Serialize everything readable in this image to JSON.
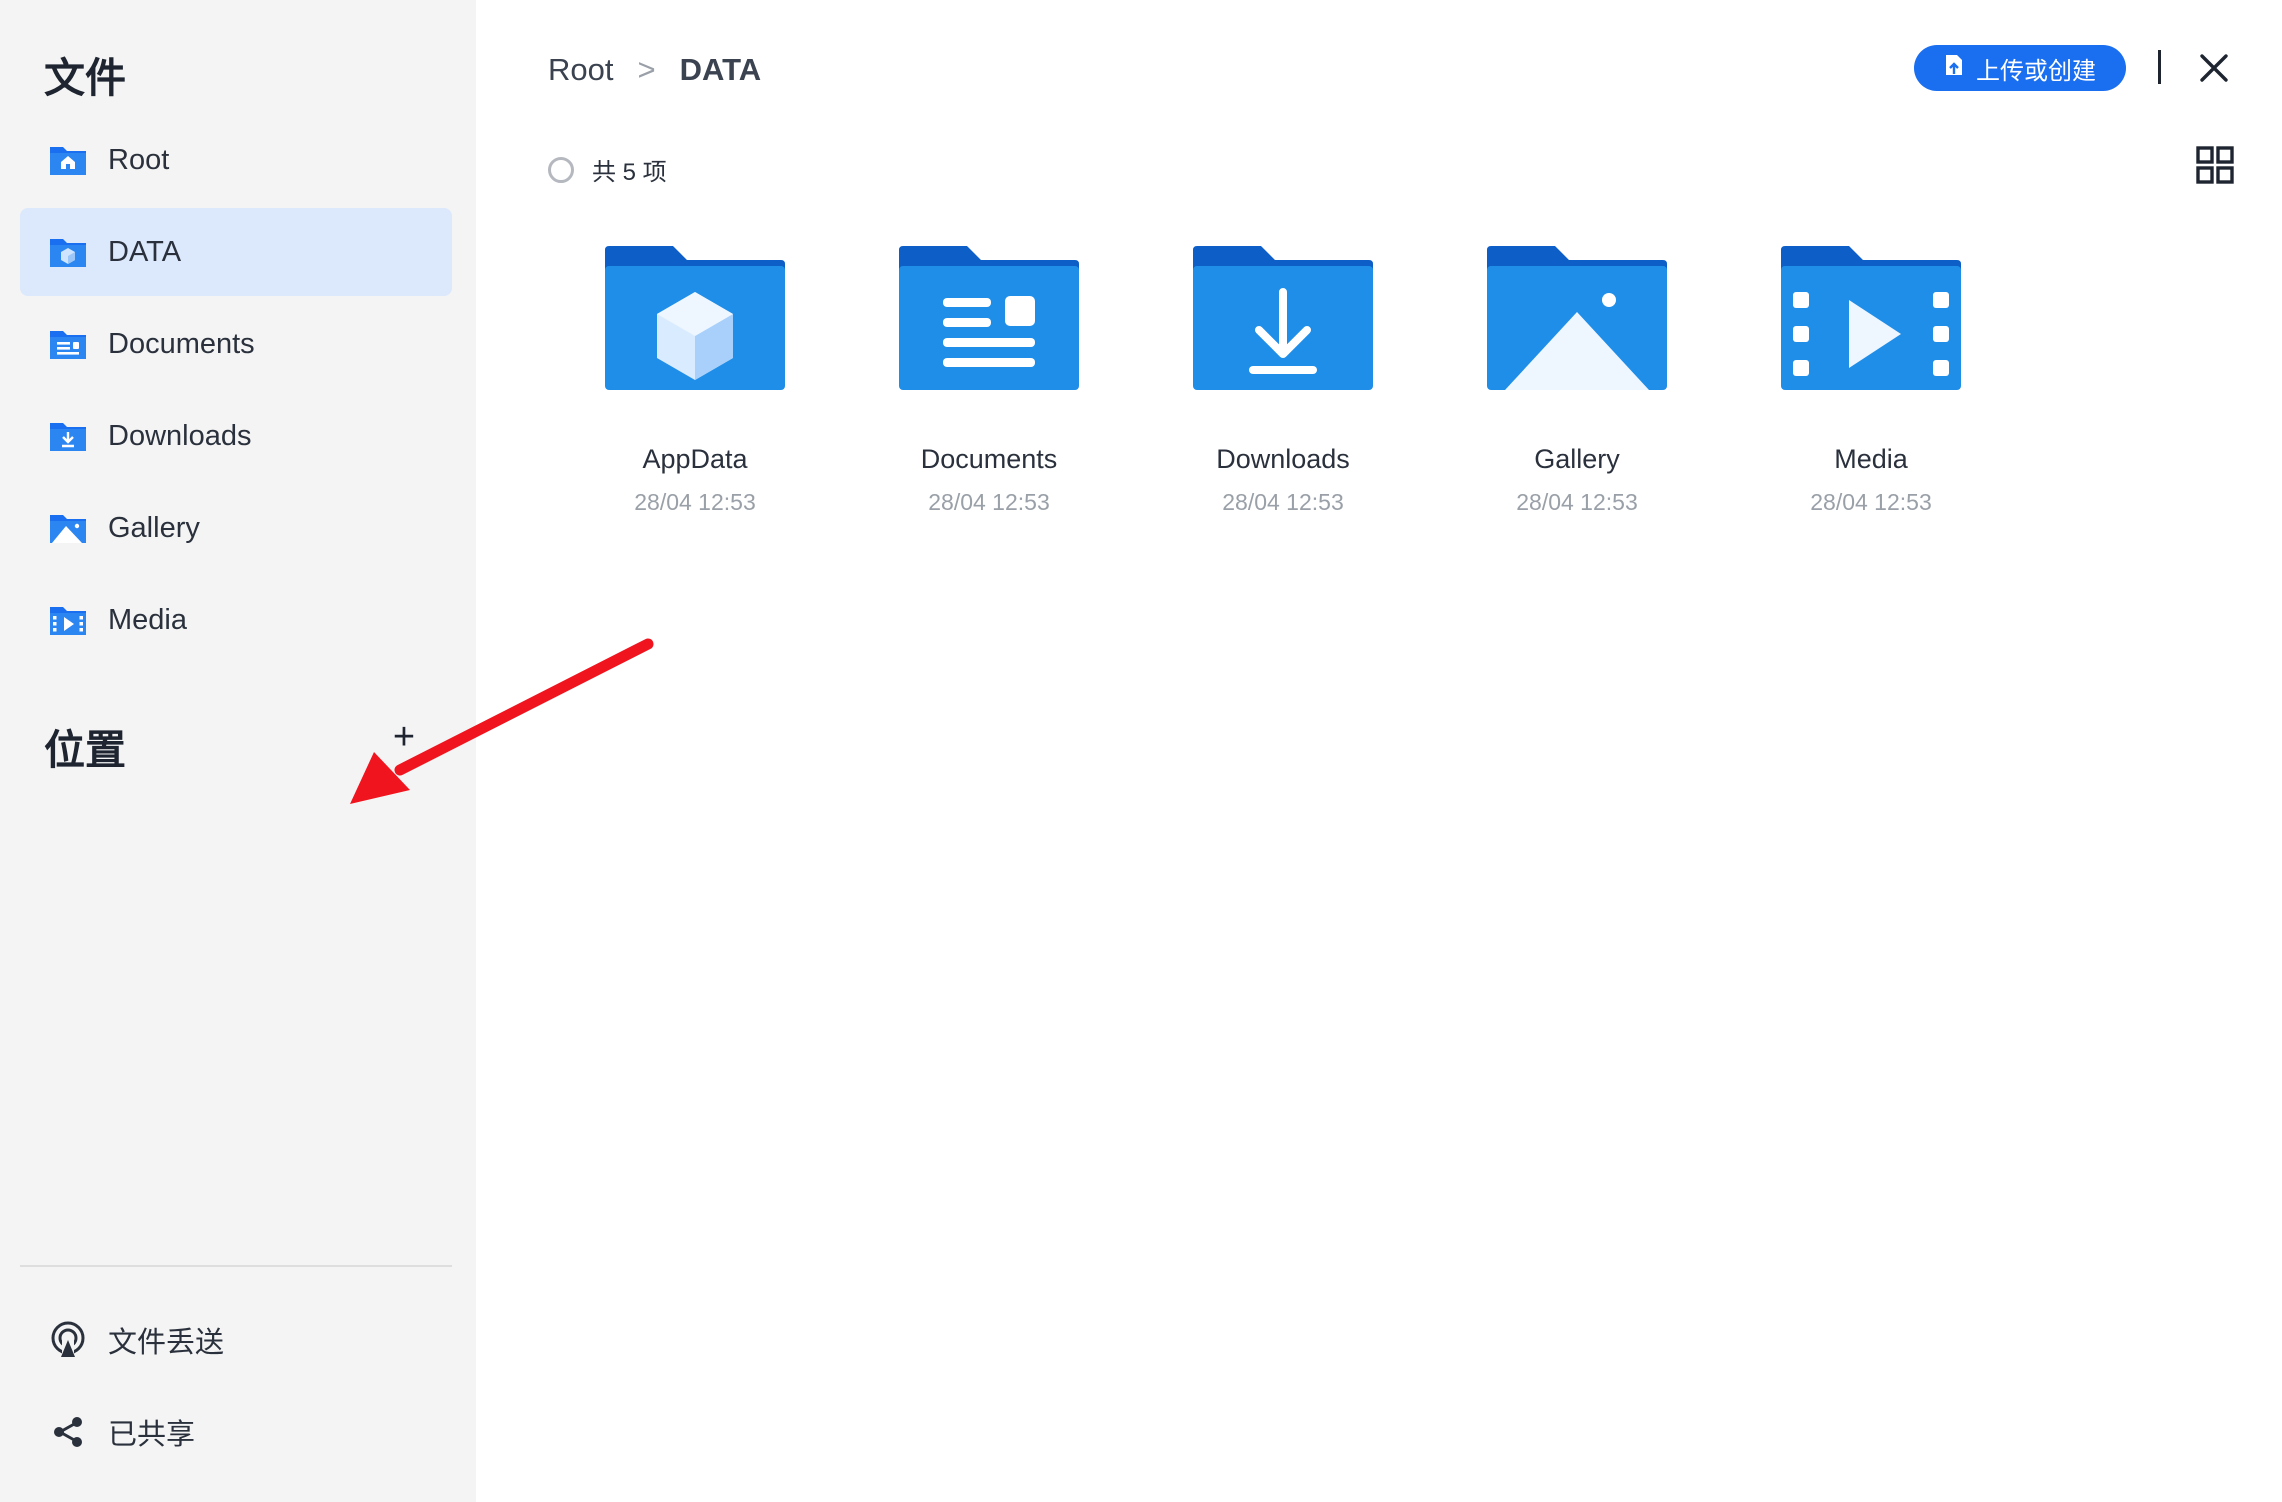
{
  "sidebar": {
    "files_heading": "文件",
    "items": [
      {
        "label": "Root",
        "icon": "home-folder-icon"
      },
      {
        "label": "DATA",
        "icon": "cube-folder-icon",
        "active": true
      },
      {
        "label": "Documents",
        "icon": "documents-folder-icon"
      },
      {
        "label": "Downloads",
        "icon": "downloads-folder-icon"
      },
      {
        "label": "Gallery",
        "icon": "gallery-folder-icon"
      },
      {
        "label": "Media",
        "icon": "media-folder-icon"
      }
    ],
    "locations_heading": "位置",
    "add_label": "+",
    "bottom_items": [
      {
        "label": "文件丢送",
        "icon": "airdrop-icon"
      },
      {
        "label": "已共享",
        "icon": "share-icon"
      }
    ]
  },
  "breadcrumb": {
    "root": "Root",
    "separator": ">",
    "current": "DATA"
  },
  "toolbar": {
    "upload_label": "上传或创建"
  },
  "summary": {
    "count_text": "共 5 项"
  },
  "folders": [
    {
      "name": "AppData",
      "date": "28/04 12:53",
      "icon": "cube-folder-icon"
    },
    {
      "name": "Documents",
      "date": "28/04 12:53",
      "icon": "documents-folder-icon"
    },
    {
      "name": "Downloads",
      "date": "28/04 12:53",
      "icon": "downloads-folder-icon"
    },
    {
      "name": "Gallery",
      "date": "28/04 12:53",
      "icon": "gallery-folder-icon"
    },
    {
      "name": "Media",
      "date": "28/04 12:53",
      "icon": "media-folder-icon"
    }
  ],
  "colors": {
    "accent": "#1a6ef0",
    "folder_back": "#0d5fc7",
    "folder_front": "#1f8ee8",
    "active_item_bg": "#dce8fb",
    "annotation_arrow": "#f0141e"
  }
}
